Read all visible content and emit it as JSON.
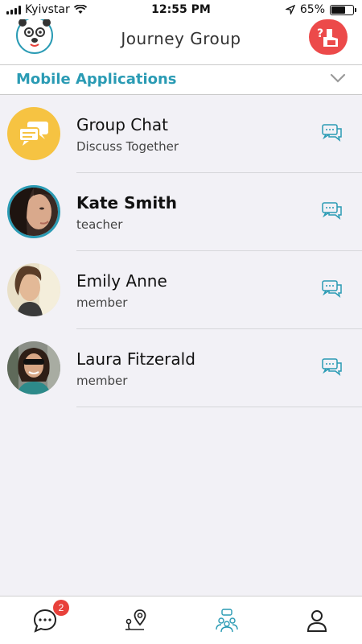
{
  "status_bar": {
    "carrier": "Kyivstar",
    "time": "12:55 PM",
    "battery": "65%",
    "battery_level": 0.65
  },
  "header": {
    "title": "Journey Group"
  },
  "group_selector": {
    "name": "Mobile Applications"
  },
  "contacts": [
    {
      "name": "Group Chat",
      "subtitle": "Discuss Together"
    },
    {
      "name": "Kate Smith",
      "subtitle": "teacher"
    },
    {
      "name": "Emily Anne",
      "subtitle": "member"
    },
    {
      "name": "Laura Fitzerald",
      "subtitle": "member"
    }
  ],
  "tabbar": {
    "chats_badge": "2"
  },
  "colors": {
    "accent": "#2a9bb4",
    "help_button": "#ec4a4a",
    "group_avatar": "#f6c342",
    "badge": "#e8413b"
  },
  "icons": {
    "help": "raised-hand-question-icon",
    "chat": "chat-bubbles-icon",
    "tab_chats": "speech-bubble-icon",
    "tab_map": "route-pin-icon",
    "tab_groups": "people-group-icon",
    "tab_profile": "person-icon"
  }
}
